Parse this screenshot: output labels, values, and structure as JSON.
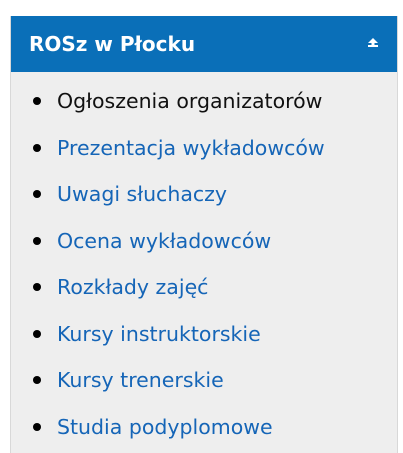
{
  "panel": {
    "title": "ROSz w Płocku",
    "collapse_icon": "collapse-up-icon",
    "colors": {
      "header_bg": "#0a6fb8",
      "body_bg": "#eeeeee",
      "link": "#1565b7",
      "active_text": "#111111"
    },
    "items": [
      {
        "label": "Ogłoszenia organizatorów",
        "active": true
      },
      {
        "label": "Prezentacja wykładowców",
        "active": false
      },
      {
        "label": "Uwagi słuchaczy",
        "active": false
      },
      {
        "label": "Ocena wykładowców",
        "active": false
      },
      {
        "label": "Rozkłady zajęć",
        "active": false
      },
      {
        "label": "Kursy instruktorskie",
        "active": false
      },
      {
        "label": "Kursy trenerskie",
        "active": false
      },
      {
        "label": "Studia podyplomowe",
        "active": false
      }
    ]
  }
}
